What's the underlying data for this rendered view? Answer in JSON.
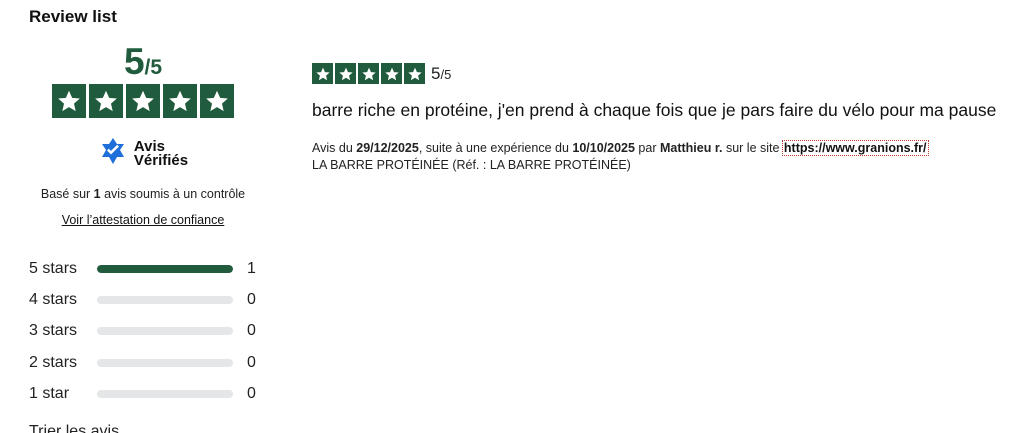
{
  "section_title": "Review list",
  "summary": {
    "score": "5",
    "score_max": "/5",
    "rating_stars": 5,
    "brand_line1": "Avis",
    "brand_line2": "Vérifiés",
    "based_prefix": "Basé sur ",
    "based_count": "1",
    "based_suffix": " avis soumis à un contrôle",
    "attestation_link": "Voir l’attestation de confiance"
  },
  "distribution": [
    {
      "label": "5 stars",
      "count": "1",
      "fraction": 1.0
    },
    {
      "label": "4 stars",
      "count": "0",
      "fraction": 0
    },
    {
      "label": "3 stars",
      "count": "0",
      "fraction": 0
    },
    {
      "label": "2 stars",
      "count": "0",
      "fraction": 0
    },
    {
      "label": "1 star",
      "count": "0",
      "fraction": 0
    }
  ],
  "sort_title": "Trier les avis",
  "review": {
    "rating_stars": 5,
    "score": "5",
    "score_max": "/5",
    "text": "barre riche en protéine, j'en prend à chaque fois que je pars faire du vélo pour ma pause",
    "meta_prefix": "Avis du ",
    "date": "29/12/2025",
    "meta_mid1": ", suite à une expérience du ",
    "experience_date": "10/10/2025",
    "meta_mid2": " par ",
    "author": "Matthieu r.",
    "meta_mid3": " sur le site ",
    "site": "https://www.granions.fr/",
    "product": "LA BARRE PROTÉINÉE (Réf. : LA BARRE PROTÉINÉE)"
  },
  "colors": {
    "brand_green": "#1f5b3c",
    "bar_empty": "#e4e6e7",
    "logo_blue": "#1e6fd9"
  }
}
